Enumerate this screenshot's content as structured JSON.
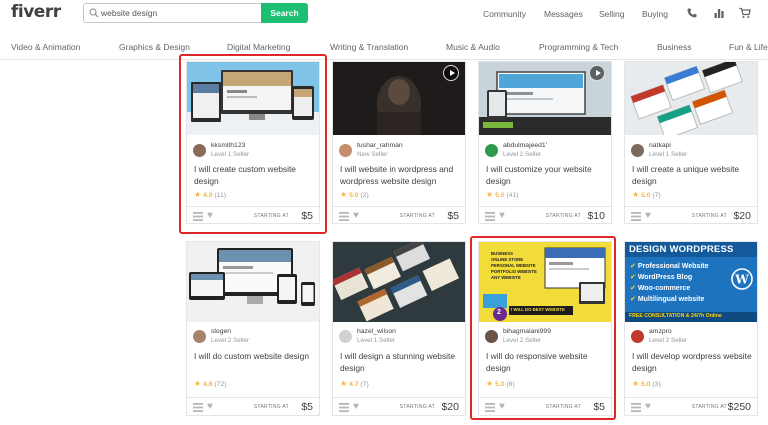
{
  "header": {
    "logo": "fiverr",
    "search_value": "website design",
    "search_button": "Search",
    "nav": [
      "Community",
      "Messages",
      "Selling",
      "Buying"
    ],
    "icons": [
      "phone-icon",
      "stats-icon",
      "cart-icon"
    ]
  },
  "categories": [
    "Video & Animation",
    "Graphics & Design",
    "Digital Marketing",
    "Writing & Translation",
    "Music & Audio",
    "Programming & Tech",
    "Business",
    "Fun & Lifestyle"
  ],
  "colors": {
    "accent": "#1dbf73",
    "highlight": "#e02727",
    "star": "#ffb33e"
  },
  "starting_label": "STARTING AT",
  "gigs": [
    {
      "seller": "kksmith123",
      "level": "Level 1 Seller",
      "title": "I will create custom website design",
      "rating": "4.9",
      "reviews": "(11)",
      "price": "$5",
      "highlighted": true
    },
    {
      "seller": "tushar_rahman",
      "level": "New Seller",
      "title": "I will website in wordpress and wordpress website design",
      "rating": "5.0",
      "reviews": "(2)",
      "price": "$5",
      "video": true
    },
    {
      "seller": "abdulmajeed1'",
      "level": "Level 2 Seller",
      "title": "I will customize your website design",
      "rating": "5.0",
      "reviews": "(41)",
      "price": "$10",
      "video": true
    },
    {
      "seller": "natkapi",
      "level": "Level 1 Seller",
      "title": "I will create a unique website design",
      "rating": "5.0",
      "reviews": "(7)",
      "price": "$20"
    },
    {
      "seller": "slogen",
      "level": "Level 2 Seller",
      "title": "I will do custom website design",
      "rating": "4.6",
      "reviews": "(72)",
      "price": "$5"
    },
    {
      "seller": "hazel_wilson",
      "level": "Level 1 Seller",
      "title": "I will design a stunning website design",
      "rating": "4.7",
      "reviews": "(7)",
      "price": "$20"
    },
    {
      "seller": "bihagmalani999",
      "level": "Level 2 Seller",
      "title": "I will do responsive website design",
      "rating": "5.0",
      "reviews": "(6)",
      "price": "$5",
      "highlighted": true,
      "thumb_text": [
        "BUSINESS",
        "ONLINE STORE",
        "PERSONAL WEBSITE",
        "PORTFOLIO WEBSITE",
        "ANY WEBSITE"
      ],
      "thumb_caption": "I WILL DO BEST WEBSITE",
      "thumb_number": "2"
    },
    {
      "seller": "amzpro",
      "level": "Level 2 Seller",
      "title": "I will develop wordpress website design",
      "rating": "5.0",
      "reviews": "(3)",
      "price": "$250",
      "thumb_title": "DESIGN WORDPRESS",
      "thumb_lines": [
        "Professional Website",
        "WordPress Blog",
        "Woo-commerce",
        "Multilingual website"
      ],
      "thumb_footer": "FREE CONSULTATION & 24/7h Online"
    }
  ]
}
